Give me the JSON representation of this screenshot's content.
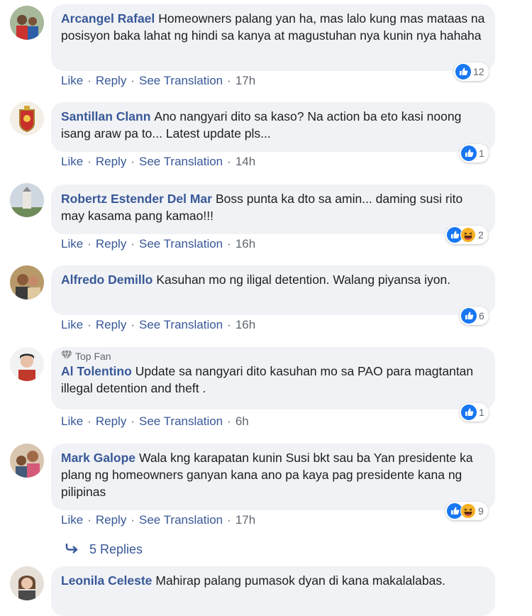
{
  "actions": {
    "like": "Like",
    "reply": "Reply",
    "translate": "See Translation",
    "separator": "·"
  },
  "colors": {
    "link": "#385898",
    "bubble": "#f0f2f5",
    "like_blue": "#1877f2",
    "haha_yellow": "#f7b125"
  },
  "comments": [
    {
      "name": "Arcangel Rafael",
      "text": "Homeowners palang yan ha, mas lalo kung mas mataas na posisyon baka lahat ng hindi sa kanya at magustuhan nya kunin nya hahaha",
      "time": "17h",
      "reactions": [
        "like-icon"
      ],
      "count": "12"
    },
    {
      "name": "Santillan Clann",
      "text": "Ano nangyari dito sa kaso? Na action ba eto kasi noong isang araw pa to... Latest update pls...",
      "time": "14h",
      "reactions": [
        "like-icon"
      ],
      "count": "1"
    },
    {
      "name": "Robertz Estender Del Mar",
      "text": "Boss punta ka dto sa amin... daming susi rito may kasama pang kamao!!!",
      "time": "16h",
      "reactions": [
        "like-icon",
        "haha-icon"
      ],
      "count": "2"
    },
    {
      "name": "Alfredo Demillo",
      "text": "Kasuhan mo ng iligal detention. Walang piyansa iyon.",
      "time": "16h",
      "reactions": [
        "like-icon"
      ],
      "count": "6"
    },
    {
      "name": "Al Tolentino",
      "badge": "Top Fan",
      "text": "Update sa nangyari dito kasuhan mo sa PAO para magtantan illegal detention and theft .",
      "time": "6h",
      "reactions": [
        "like-icon"
      ],
      "count": "1"
    },
    {
      "name": "Mark Galope",
      "text": "Wala kng karapatan kunin Susi bkt sau ba Yan presidente ka plang ng homeowners ganyan kana ano pa kaya pag presidente kana ng pilipinas",
      "time": "17h",
      "reactions": [
        "like-icon",
        "haha-icon"
      ],
      "count": "9"
    },
    {
      "name": "Leonila Celeste",
      "text": "Mahirap palang pumasok dyan di kana makalalabas."
    }
  ],
  "replies_label": "5 Replies"
}
